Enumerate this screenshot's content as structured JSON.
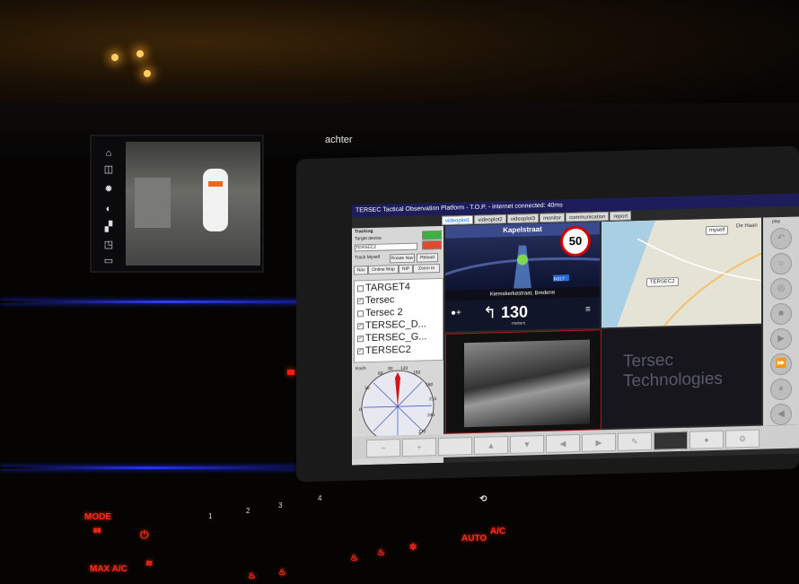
{
  "colors": {
    "ambient": "#2d3dff",
    "climate_red": "#ff2a1a",
    "title_bar": "#1d1d5c"
  },
  "bmw": {
    "label": "achter",
    "icons": [
      "home-icon",
      "camera-view-icon",
      "sun-icon",
      "contrast-icon",
      "parking-sensor-icon",
      "camera-icon",
      "trailer-icon"
    ]
  },
  "tablet": {
    "title": "TERSEC Tactical Observation Platform - T.O.P. - internet connected: 40ms",
    "tabs": [
      "videoplot1",
      "videoplot2",
      "videoplot3",
      "monitor",
      "communication",
      "report"
    ],
    "left": {
      "header": "Tracking",
      "target_device_label": "Target device",
      "target_device_value": "TERSEC2",
      "track_myself": "Track Myself",
      "buttons": [
        "Rotate Nav",
        "Reload",
        "Nav",
        "Online Map",
        "NIP",
        "Zoom to"
      ],
      "targets": [
        {
          "name": "TARGET4",
          "checked": false
        },
        {
          "name": "Tersec",
          "checked": true
        },
        {
          "name": "Tersec 2",
          "checked": false
        },
        {
          "name": "TERSEC_D...",
          "checked": true
        },
        {
          "name": "TERSEC_G...",
          "checked": true
        },
        {
          "name": "TERSEC2",
          "checked": true
        }
      ],
      "compass_unit": "Km/h",
      "compass_ticks": [
        "60",
        "90",
        "120",
        "150",
        "180",
        "210",
        "240",
        "30",
        "270",
        "300",
        "330",
        "0"
      ]
    },
    "nav": {
      "street": "Kapelstraat",
      "speed_limit": "50",
      "current_street": "Kiemskerkestraat, Bredene",
      "distance": "130",
      "distance_unit": "meters",
      "road_tag": "N317"
    },
    "map": {
      "labels": [
        "myself",
        "TERSEC2",
        "De Haan"
      ]
    },
    "logo": {
      "line1": "Tersec",
      "line2": "Technologies"
    },
    "right_label": "play"
  },
  "climate": {
    "labels": [
      "MODE",
      "MAX A/C",
      "AUTO",
      "A/C"
    ],
    "numbers": [
      "1",
      "2",
      "3",
      "4"
    ]
  }
}
